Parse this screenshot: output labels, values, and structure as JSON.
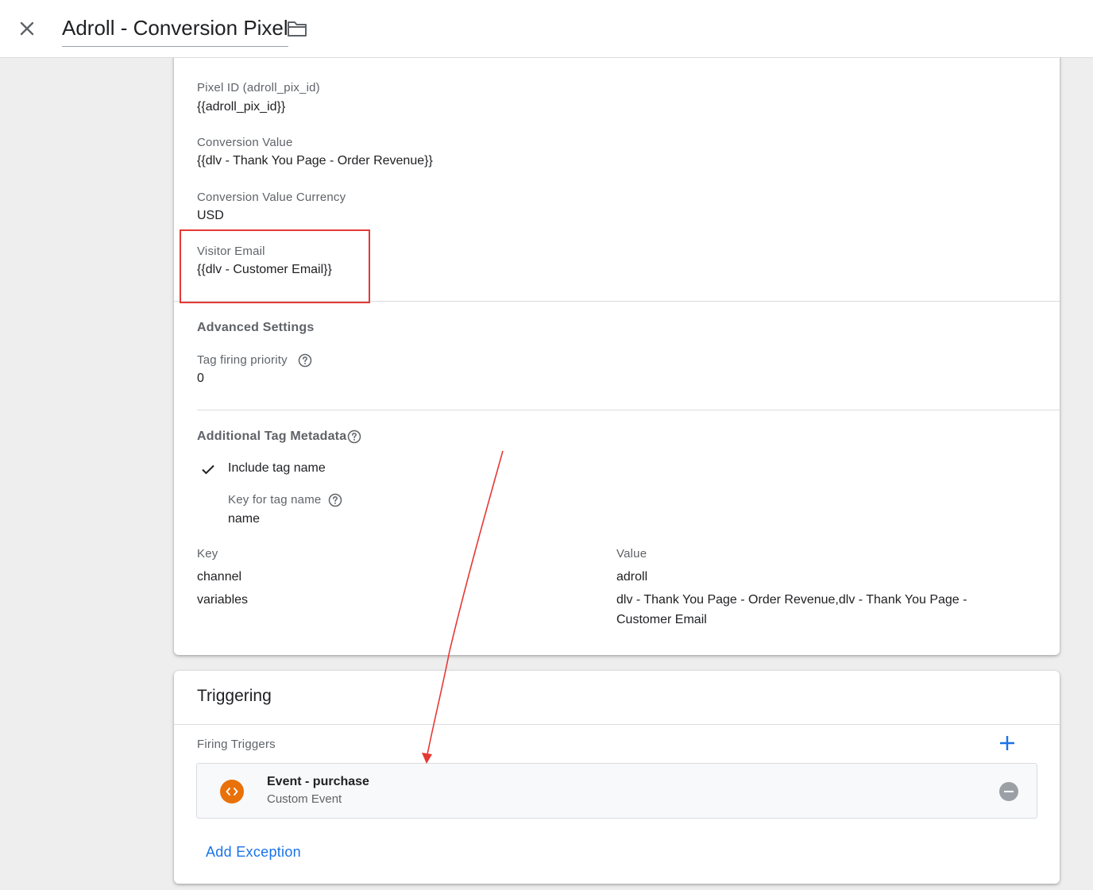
{
  "header": {
    "title": "Adroll - Conversion Pixel"
  },
  "tag_config": {
    "fields": [
      {
        "label": "Pixel ID (adroll_pix_id)",
        "value": "{{adroll_pix_id}}"
      },
      {
        "label": "Conversion Value",
        "value": "{{dlv - Thank You Page - Order Revenue}}"
      },
      {
        "label": "Conversion Value Currency",
        "value": "USD"
      },
      {
        "label": "Visitor Email",
        "value": "{{dlv - Customer Email}}"
      }
    ]
  },
  "advanced_settings": {
    "title": "Advanced Settings",
    "priority_label": "Tag firing priority",
    "priority_value": "0"
  },
  "metadata": {
    "title": "Additional Tag Metadata",
    "include_tag_name_label": "Include tag name",
    "include_tag_name_checked": true,
    "key_for_tag_name_label": "Key for tag name",
    "key_for_tag_name_value": "name",
    "table": {
      "headers": {
        "key": "Key",
        "value": "Value"
      },
      "rows": [
        {
          "key": "channel",
          "value": "adroll"
        },
        {
          "key": "variables",
          "value_line1": "dlv - Thank You Page - Order Revenue,dlv - Thank You Page -",
          "value_line2": "Customer Email"
        }
      ]
    }
  },
  "triggering": {
    "title": "Triggering",
    "firing_label": "Firing Triggers",
    "triggers": [
      {
        "name": "Event - purchase",
        "type": "Custom Event",
        "icon": "custom-event-icon",
        "icon_color": "#e8710a"
      }
    ],
    "add_exception_label": "Add Exception"
  },
  "colors": {
    "accent": "#1a73e8",
    "annotation": "#e53935"
  }
}
